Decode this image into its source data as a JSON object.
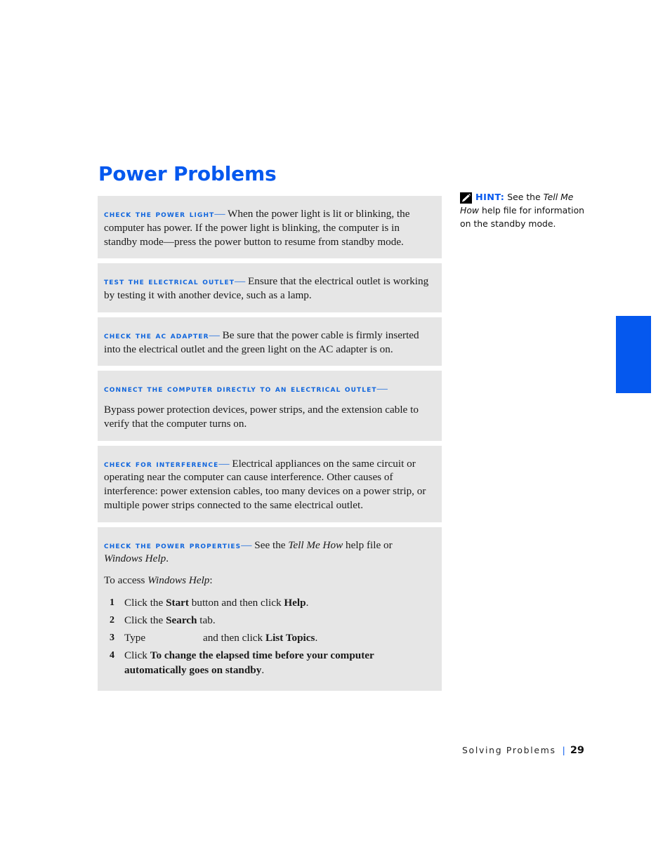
{
  "title": "Power Problems",
  "theme": {
    "accent_blue": "#0558EE",
    "lead_blue": "#1166DD",
    "panel_bg": "#E6E6E6",
    "page_bg": "#FFFFFF",
    "body_text": "#1A1A1A"
  },
  "panels": [
    {
      "lead": "Check the power light",
      "dash": "—",
      "body": " When the power light is lit or blinking, the computer has power. If the power light is blinking, the computer is in standby mode—press the power button to resume from standby mode."
    },
    {
      "lead": "Test the electrical outlet",
      "dash": "—",
      "body": " Ensure that the electrical outlet is working by testing it with another device, such as a lamp."
    },
    {
      "lead": "Check the AC adapter",
      "dash": "—",
      "body": " Be sure that the power cable is firmly inserted into the electrical outlet and the green light on the AC adapter is on."
    },
    {
      "lead": "Connect the computer directly to an electrical outlet",
      "dash": "—",
      "body": "Bypass power protection devices, power strips, and the extension cable to verify that the computer turns on."
    },
    {
      "lead": "Check for interference",
      "dash": "—",
      "body": " Electrical appliances on the same circuit or operating near the computer can cause interference. Other causes of interference: power extension cables, too many devices on a power strip, or multiple power strips connected to the same electrical outlet."
    }
  ],
  "power_properties": {
    "lead": "Check the Power Properties",
    "dash": "—",
    "intro_before": " See the ",
    "intro_italic_1": "Tell Me How",
    "intro_middle": " help file or ",
    "intro_italic_2": "Windows Help",
    "intro_after": ".",
    "access_before": "To access ",
    "access_italic": "Windows Help",
    "access_after": ":",
    "steps": [
      {
        "parts": [
          {
            "text": "Click the ",
            "style": "normal"
          },
          {
            "text": "Start",
            "style": "bold"
          },
          {
            "text": " button and then click ",
            "style": "normal"
          },
          {
            "text": "Help",
            "style": "bold"
          },
          {
            "text": ".",
            "style": "normal"
          }
        ]
      },
      {
        "parts": [
          {
            "text": "Click the ",
            "style": "normal"
          },
          {
            "text": "Search",
            "style": "bold"
          },
          {
            "text": " tab.",
            "style": "normal"
          }
        ]
      },
      {
        "parts": [
          {
            "text": "Type",
            "style": "normal"
          },
          {
            "text": "",
            "style": "blank"
          },
          {
            "text": " and then click ",
            "style": "normal"
          },
          {
            "text": "List Topics",
            "style": "bold"
          },
          {
            "text": ".",
            "style": "normal"
          }
        ]
      },
      {
        "parts": [
          {
            "text": "Click ",
            "style": "normal"
          },
          {
            "text": "To change the elapsed time before your computer automatically goes on standby",
            "style": "bold"
          },
          {
            "text": ".",
            "style": "normal"
          }
        ]
      }
    ]
  },
  "hint": {
    "icon": "pencil-icon",
    "label": "HINT:",
    "text_before": " See the ",
    "italic_1": "Tell Me How",
    "text_after": " help file for information on the standby mode."
  },
  "edge_tab": {
    "color": "#0558EE",
    "label": ""
  },
  "footer": {
    "section": "Solving Problems",
    "separator": "|",
    "page_number": "29"
  }
}
